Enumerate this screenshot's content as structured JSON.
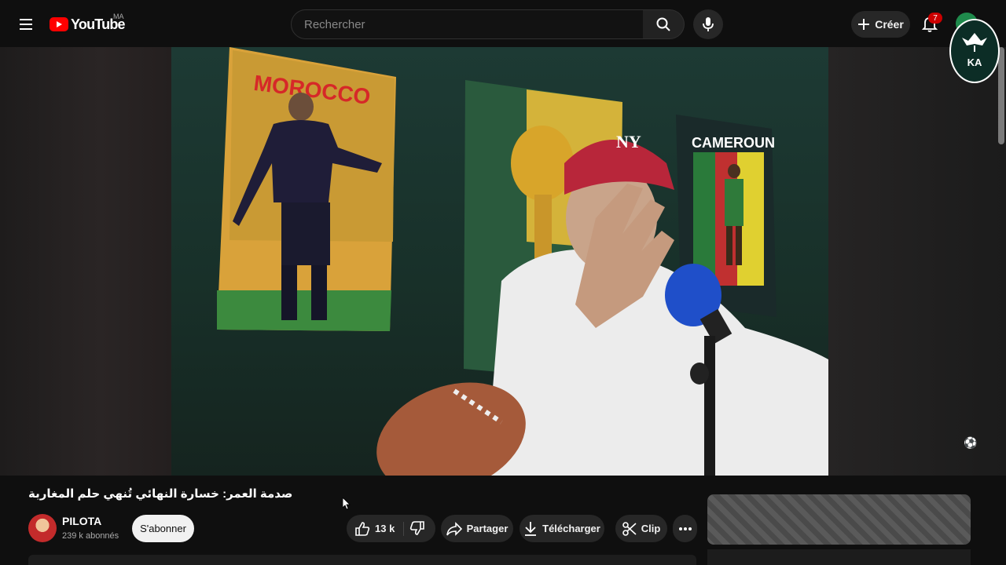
{
  "header": {
    "logo_text": "YouTube",
    "region": "MA",
    "search_placeholder": "Rechercher",
    "create_label": "Créer",
    "notification_count": "7"
  },
  "video": {
    "title": "صدمة العمر: خسارة النهائي تُنهي حلم المغاربة",
    "poster_left_text": "MOROCCO",
    "poster_right_text": "CAMEROUN",
    "cap_text": "NY"
  },
  "channel": {
    "name": "PILOTA",
    "subscribers": "239 k abonnés",
    "subscribe_label": "S'abonner"
  },
  "actions": {
    "likes": "13 k",
    "share_label": "Partager",
    "download_label": "Télécharger",
    "clip_label": "Clip"
  },
  "colors": {
    "brand_red": "#ff0000",
    "background": "#0f0f0f",
    "button_bg": "#272727"
  }
}
